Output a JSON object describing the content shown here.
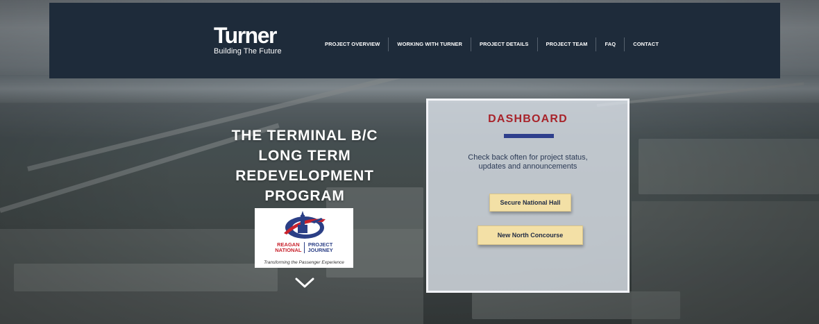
{
  "brand": {
    "name": "Turner",
    "tagline": "Building The Future"
  },
  "nav": {
    "items": [
      {
        "label": "PROJECT OVERVIEW"
      },
      {
        "label": "WORKING WITH TURNER"
      },
      {
        "label": "PROJECT DETAILS"
      },
      {
        "label": "PROJECT TEAM"
      },
      {
        "label": "FAQ"
      },
      {
        "label": "CONTACT"
      }
    ]
  },
  "hero": {
    "title_lines": [
      "THE TERMINAL B/C",
      "LONG TERM",
      "REDEVELOPMENT",
      "PROGRAM"
    ]
  },
  "badge": {
    "left_line1": "REAGAN",
    "left_line2": "NATIONAL",
    "right_line1": "PROJECT",
    "right_line2": "JOURNEY",
    "caption": "Transforming the Passenger Experience"
  },
  "dashboard": {
    "title": "DASHBOARD",
    "text_line1": "Check back often for project status,",
    "text_line2": "updates and announcements",
    "buttons": [
      {
        "label": "Secure National Hall"
      },
      {
        "label": "New North Concourse"
      }
    ]
  },
  "colors": {
    "navbar": "#1e2b3a",
    "dashboard_title": "#a8232a",
    "dashboard_rule": "#2e3f8c",
    "button_bg": "#f3e0a6"
  },
  "icons": {
    "scroll": "chevron-down-icon",
    "badge": "capitol-plane-logo-icon"
  }
}
